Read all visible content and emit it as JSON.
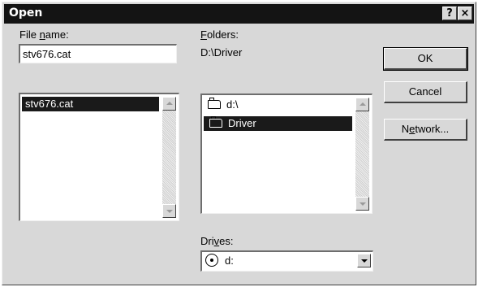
{
  "window": {
    "title": "Open",
    "help_label": "?",
    "close_label": "×"
  },
  "file_name": {
    "label_pre": "File ",
    "label_key": "n",
    "label_post": "ame:",
    "value": "stv676.cat",
    "list": [
      "stv676.cat"
    ]
  },
  "folders": {
    "label_key": "F",
    "label_post": "olders:",
    "current_path": "D:\\Driver",
    "items": [
      {
        "label": "d:\\",
        "selected": false
      },
      {
        "label": "Driver",
        "selected": true
      }
    ]
  },
  "drives": {
    "label_pre": "Dri",
    "label_key": "v",
    "label_post": "es:",
    "value": "d:"
  },
  "buttons": {
    "ok": "OK",
    "cancel": "Cancel",
    "network_pre": "N",
    "network_key": "e",
    "network_post": "twork..."
  },
  "icons": {
    "folder_open": "folder-open-icon",
    "drive": "cd-drive-icon"
  }
}
